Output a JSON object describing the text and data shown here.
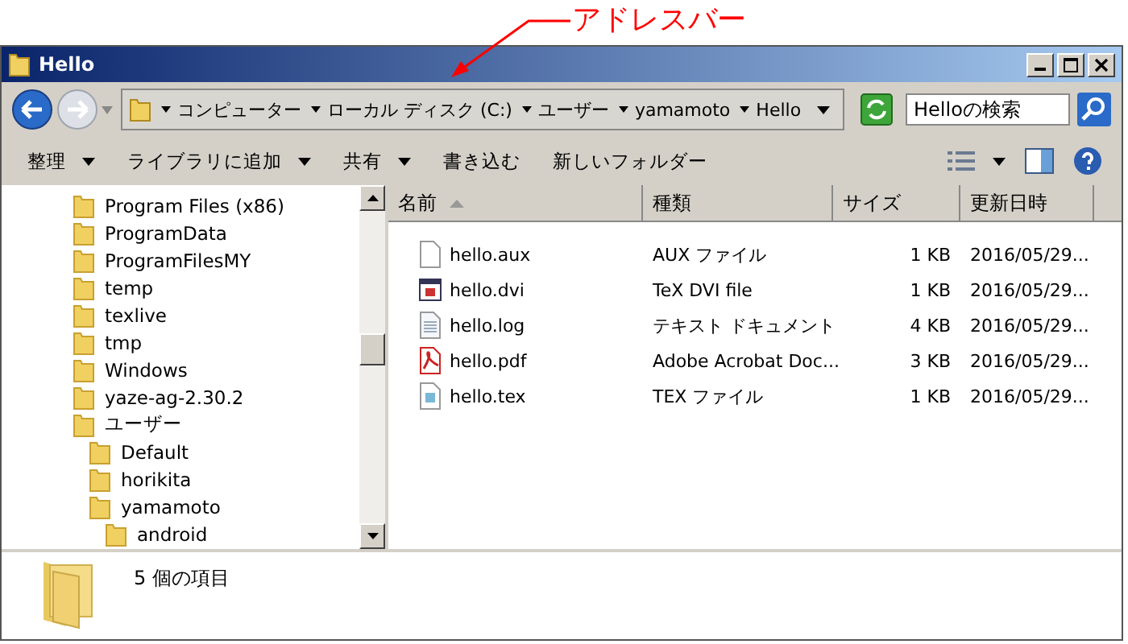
{
  "annotation": {
    "label": "アドレスバー"
  },
  "window": {
    "title": "Hello"
  },
  "address_bar": {
    "crumbs": [
      "コンピューター",
      "ローカル ディスク (C:)",
      "ユーザー",
      "yamamoto",
      "Hello"
    ]
  },
  "search": {
    "placeholder": "Helloの検索"
  },
  "toolbar": {
    "buttons": [
      {
        "label": "整理",
        "dropdown": true
      },
      {
        "label": "ライブラリに追加",
        "dropdown": true
      },
      {
        "label": "共有",
        "dropdown": true
      },
      {
        "label": "書き込む",
        "dropdown": false
      },
      {
        "label": "新しいフォルダー",
        "dropdown": false
      }
    ]
  },
  "tree": {
    "items": [
      {
        "label": "Program Files (x86)"
      },
      {
        "label": "ProgramData"
      },
      {
        "label": "ProgramFilesMY"
      },
      {
        "label": "temp"
      },
      {
        "label": "texlive"
      },
      {
        "label": "tmp"
      },
      {
        "label": "Windows"
      },
      {
        "label": "yaze-ag-2.30.2"
      },
      {
        "label": "ユーザー",
        "children": [
          {
            "label": "Default"
          },
          {
            "label": "horikita"
          },
          {
            "label": "yamamoto",
            "children": [
              {
                "label": "android"
              }
            ]
          }
        ]
      }
    ]
  },
  "table": {
    "columns": [
      {
        "label": "名前",
        "sorted": true
      },
      {
        "label": "種類",
        "sorted": false
      },
      {
        "label": "サイズ",
        "sorted": false
      },
      {
        "label": "更新日時",
        "sorted": false
      }
    ],
    "rows": [
      {
        "kind": "blank",
        "name": "hello.aux",
        "type": "AUX ファイル",
        "size": "1 KB",
        "modified": "2016/05/29..."
      },
      {
        "kind": "dvi",
        "name": "hello.dvi",
        "type": "TeX DVI file",
        "size": "1 KB",
        "modified": "2016/05/29..."
      },
      {
        "kind": "text",
        "name": "hello.log",
        "type": "テキスト ドキュメント",
        "size": "4 KB",
        "modified": "2016/05/29..."
      },
      {
        "kind": "pdf",
        "name": "hello.pdf",
        "type": "Adobe Acrobat Doc...",
        "size": "3 KB",
        "modified": "2016/05/29..."
      },
      {
        "kind": "tex",
        "name": "hello.tex",
        "type": "TEX ファイル",
        "size": "1 KB",
        "modified": "2016/05/29..."
      }
    ]
  },
  "status_bar": {
    "count": "5 個の項目"
  }
}
